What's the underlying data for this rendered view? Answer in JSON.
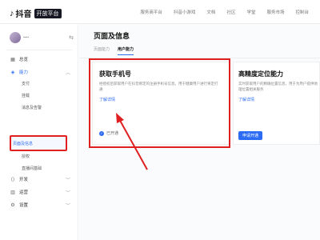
{
  "header": {
    "logo_mark": "♪",
    "app_name": "抖音",
    "app_tag": "开放平台",
    "nav": [
      "服务商平台",
      "抖音小游戏",
      "文档",
      "社区",
      "学堂",
      "服务市场",
      "控制台"
    ]
  },
  "sidebar": {
    "account_name": "▪▪▪▪",
    "switch_icon": "⇆",
    "items": [
      {
        "label": "总览",
        "icon": "grid-icon"
      },
      {
        "label": "能力",
        "icon": "cube-icon",
        "expanded": true
      },
      {
        "label": "开发",
        "icon": "code-icon"
      },
      {
        "label": "运营",
        "icon": "chart-icon"
      },
      {
        "label": "设置",
        "icon": "gear-icon"
      }
    ],
    "sub_items": [
      "支付",
      "挂载",
      "消息及告警",
      "页面及信息",
      "授权",
      "直播间基础"
    ],
    "selected_sub": "页面及信息"
  },
  "main": {
    "page_title": "页面及信息",
    "tabs": [
      "页面能力",
      "用户能力"
    ],
    "active_tab": "用户能力",
    "card1": {
      "title": "获取手机号",
      "desc": "经授权后获取用户在抖音绑定的注册手机号信息，用于健康用户进行将定打通",
      "link": "了解详情",
      "status": "已开通"
    },
    "card2": {
      "title": "高精度定位能力",
      "desc": "实时获取用户的精确位置信息，用于为用户提供地理位置相关服务",
      "link": "了解详情",
      "button": "申请开通"
    }
  },
  "colors": {
    "accent": "#2c6cf5",
    "highlight": "#e02020"
  }
}
